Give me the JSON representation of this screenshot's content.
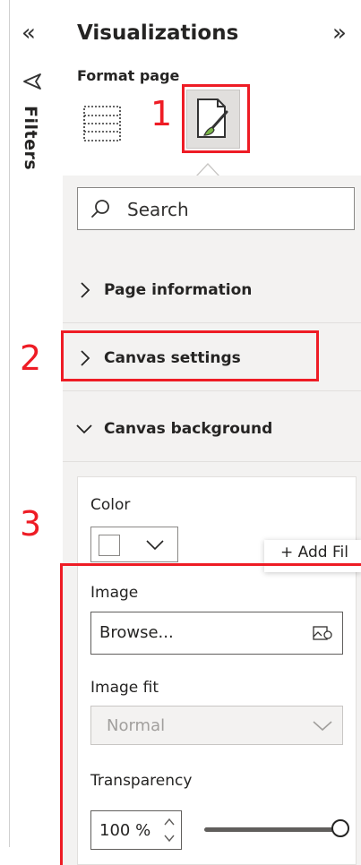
{
  "filters_pane": {
    "label": "Filters",
    "collapse_icon": "double-chevron-left-icon",
    "filter_icon": "filter-icon"
  },
  "visualizations_pane": {
    "title": "Visualizations",
    "expand_icon": "double-chevron-right-icon",
    "format_page_label": "Format page",
    "tabs": [
      {
        "name": "build-visual",
        "icon": "table-grid-icon",
        "selected": false
      },
      {
        "name": "format-page",
        "icon": "paintbrush-page-icon",
        "selected": true
      }
    ],
    "search": {
      "placeholder": "Search",
      "icon": "search-icon"
    }
  },
  "sections": [
    {
      "label": "Page information",
      "expanded": false
    },
    {
      "label": "Canvas settings",
      "expanded": false
    },
    {
      "label": "Canvas background",
      "expanded": true
    }
  ],
  "canvas_background": {
    "color_label": "Color",
    "color_value": "#ffffff",
    "tooltip": "+ Add Fil",
    "image_label": "Image",
    "image_value": "Browse...",
    "image_fit_label": "Image fit",
    "image_fit_value": "Normal",
    "transparency_label": "Transparency",
    "transparency_value": "100 %",
    "transparency_percent": 100
  },
  "annotations": [
    "1",
    "2",
    "3"
  ],
  "colors": {
    "annotation_red": "#ee1c25",
    "pane_band": "#f3f2f1",
    "selected_tab": "#e1dfdd"
  }
}
